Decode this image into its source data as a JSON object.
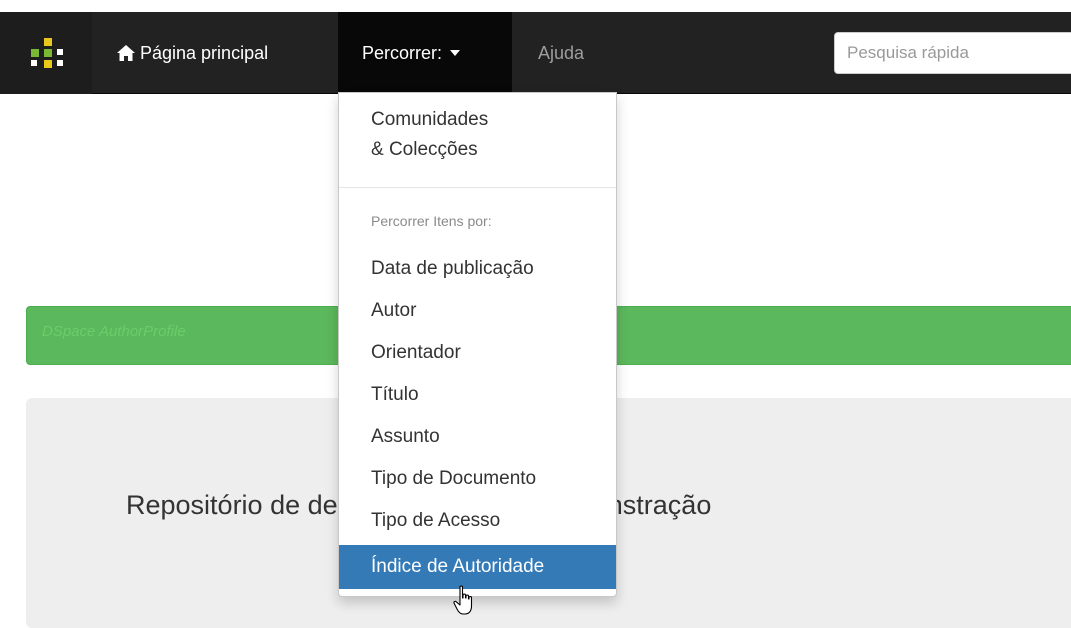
{
  "navbar": {
    "home_label": "Página principal",
    "browse_label": "Percorrer:",
    "help_label": "Ajuda",
    "search_placeholder": "Pesquisa rápida"
  },
  "banner": {
    "text": "DSpace AuthorProfile"
  },
  "main": {
    "headline": "Repositório de desenvolvimento e demonstração"
  },
  "browse_menu": {
    "communities_line1": "Comunidades",
    "communities_line2": "& Colecções",
    "header": "Percorrer Itens por:",
    "items": [
      "Data de publicação",
      "Autor",
      "Orientador",
      "Título",
      "Assunto",
      "Tipo de Documento",
      "Tipo de Acesso",
      "Índice de Autoridade"
    ]
  },
  "colors": {
    "navbar": "#222222",
    "active_nav": "#080808",
    "banner": "#5cb85c",
    "menu_highlight": "#337ab7"
  }
}
